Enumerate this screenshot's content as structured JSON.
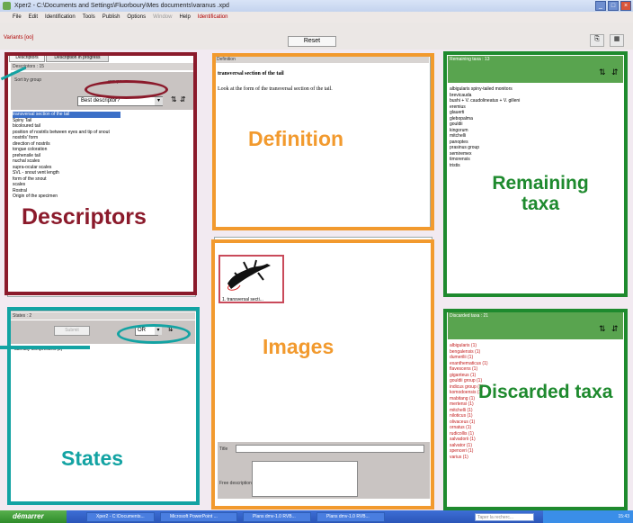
{
  "window": {
    "title": "Xper2 - C:\\Documents and Settings\\Fluorboury\\Mes documents\\varanus .xpd",
    "menus": [
      "File",
      "Edit",
      "Identification",
      "Tools",
      "Publish",
      "Options",
      "Window",
      "Help",
      "Identification"
    ]
  },
  "toolbar": {
    "variants_label": "Variants [oo]",
    "reset_label": "Reset"
  },
  "descriptors_panel": {
    "tabs": [
      "Descriptors",
      "Description in progress"
    ],
    "header": "Descriptors : 15",
    "sort_label": "Sort by group",
    "group_label": "groups",
    "dropdown_value": "Best descriptor?",
    "items": [
      "transversal section of the tail",
      "Spiny Tail",
      "bicoloured tail",
      "position of nostrils between eyes and tip of snout",
      "nostrils' form",
      "direction of nostrils",
      "tongue coloration",
      "prehensile tail",
      "nuchal scales",
      "supra-ocular scales",
      "SVL - snout vent length",
      "form of the snout",
      "scales",
      "Rostral",
      "Origin of the specimen"
    ]
  },
  "states_panel": {
    "header": "States : 2",
    "submit_label": "Submit",
    "mode_value": "OR",
    "items": [
      "laterally compressed (2)"
    ]
  },
  "definition_panel": {
    "header": "Definition",
    "title": "transversal section of the tail",
    "text": "Look at the form of the transversal section of the tail."
  },
  "images_panel": {
    "caption": "1. transversal secti...",
    "field_label": "Title",
    "note_label": "Free description"
  },
  "remaining_panel": {
    "header": "Remaining taxa : 13",
    "items": [
      "albigularis spiny-tailed monitors",
      "brevicauda",
      "bushi + V. caudolineatus + V. gilleni",
      "eremius",
      "glauerti",
      "glebopalma",
      "gouldii",
      "kingorum",
      "mitchelli",
      "panoptes",
      "prasinus group",
      "semiremex",
      "timorensis",
      "tristis"
    ]
  },
  "discarded_panel": {
    "header": "Discarded taxa : 21",
    "items": [
      "albigularis (1)",
      "bengalensis (1)",
      "dumerilii (1)",
      "exanthematicus (1)",
      "flavescens (1)",
      "giganteus (1)",
      "gouldii group (1)",
      "indicus group (1)",
      "komodoensis (1)",
      "mabitang (1)",
      "mertensi (1)",
      "mitchelli (1)",
      "niloticus (1)",
      "olivaceus (1)",
      "ornatus (1)",
      "rudicollis (1)",
      "salvadorii (1)",
      "salvator (1)",
      "spenceri (1)",
      "varius (1)"
    ]
  },
  "overlays": {
    "descriptors": "Descriptors",
    "definition": "Definition",
    "remaining": "Remaining taxa",
    "images": "Images",
    "states": "States",
    "discarded": "Discarded taxa"
  },
  "taskbar": {
    "start_label": "démarrer",
    "items": [
      "Xper2 - C:\\Documents...",
      "Microsoft PowerPoint ...",
      "Plans dmv-1.0 RVB...",
      "Plans dmv-1.0 RVB..."
    ],
    "search_placeholder": "Taper la recherc...",
    "clock": "15:43"
  },
  "colors": {
    "descriptors_box": "#8b1a2b",
    "definition_box": "#f29a2e",
    "remaining_box": "#1e8a2e",
    "states_box": "#13a3a3",
    "pink_accent": "#ee45b5"
  }
}
